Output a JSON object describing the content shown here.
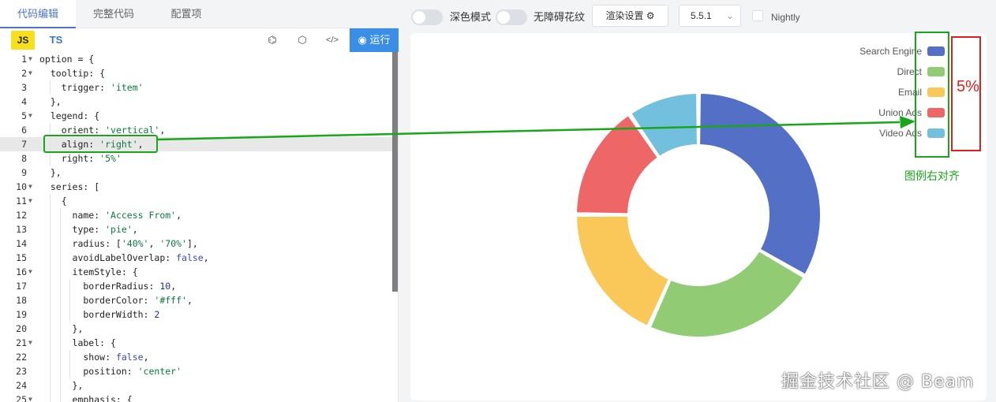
{
  "tabs": [
    "代码编辑",
    "完整代码",
    "配置项"
  ],
  "lang": {
    "js": "JS",
    "ts": "TS"
  },
  "tools": {
    "codepen": "⌬",
    "cube": "⬡",
    "code": "</>"
  },
  "run_label": "运行",
  "toolbar": {
    "dark_mode": "深色模式",
    "accessibility": "无障碍花纹",
    "render_settings": "渲染设置",
    "version": "5.5.1",
    "nightly": "Nightly"
  },
  "code_lines": [
    "option = {",
    "  tooltip: {",
    "    trigger: 'item'",
    "  },",
    "  legend: {",
    "    orient: 'vertical',",
    "    align: 'right',",
    "    right: '5%'",
    "  },",
    "  series: [",
    "    {",
    "      name: 'Access From',",
    "      type: 'pie',",
    "      radius: ['40%', '70%'],",
    "      avoidLabelOverlap: false,",
    "      itemStyle: {",
    "        borderRadius: 10,",
    "        borderColor: '#fff',",
    "        borderWidth: 2",
    "      },",
    "      label: {",
    "        show: false,",
    "        position: 'center'",
    "      },",
    "      emphasis: {"
  ],
  "chart_data": {
    "type": "pie",
    "categories": [
      "Search Engine",
      "Direct",
      "Email",
      "Union Ads",
      "Video Ads"
    ],
    "values": [
      1048,
      735,
      580,
      484,
      300
    ],
    "colors": [
      "#5470c6",
      "#91cc75",
      "#fac858",
      "#ee6666",
      "#73c0de"
    ]
  },
  "annotations": {
    "legend_right_align": "图例右对齐",
    "right_percent": "5%"
  },
  "watermark": "掘金技术社区 @ Beam"
}
